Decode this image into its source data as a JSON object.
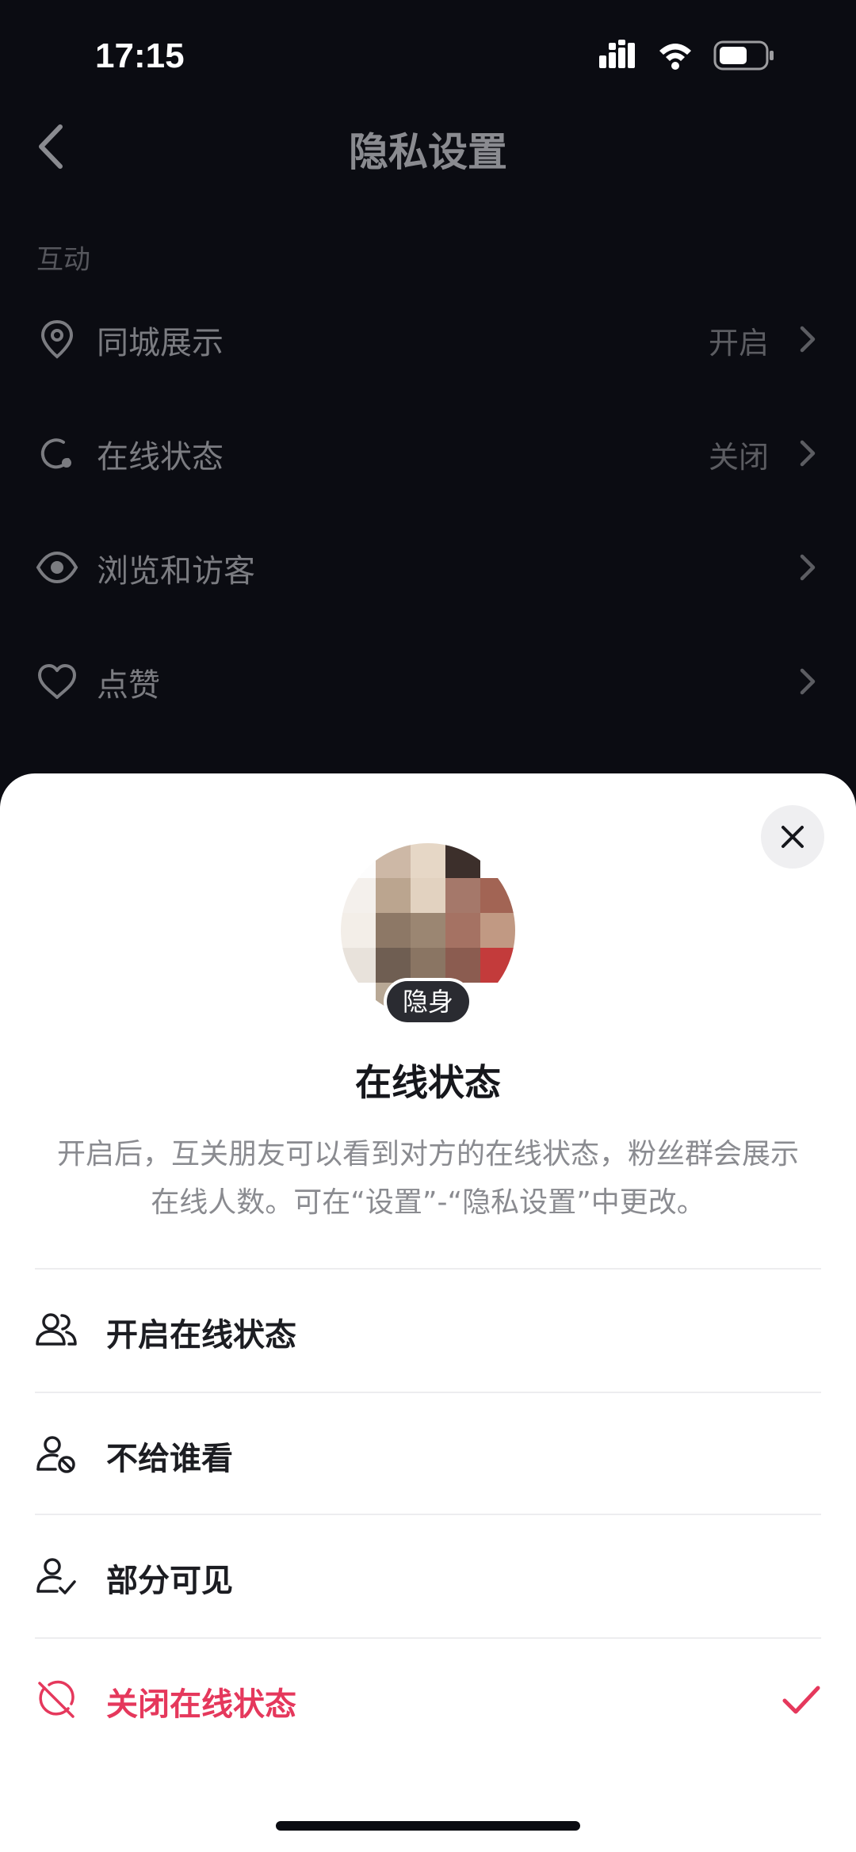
{
  "status_bar": {
    "time": "17:15",
    "icons": [
      "signal-icon",
      "wifi-icon",
      "battery-icon"
    ]
  },
  "nav": {
    "title": "隐私设置",
    "back_icon": "chevron-left-icon"
  },
  "section": {
    "label": "互动"
  },
  "settings": [
    {
      "icon": "location-pin-icon",
      "label": "同城展示",
      "value": "开启"
    },
    {
      "icon": "online-status-icon",
      "label": "在线状态",
      "value": "关闭"
    },
    {
      "icon": "eye-icon",
      "label": "浏览和访客",
      "value": ""
    },
    {
      "icon": "heart-icon",
      "label": "点赞",
      "value": ""
    }
  ],
  "sheet": {
    "badge": "隐身",
    "title": "在线状态",
    "description": "开启后，互关朋友可以看到对方的在线状态，粉丝群会展示在线人数。可在“设置”-“隐私设置”中更改。",
    "options": [
      {
        "icon": "group-icon",
        "label": "开启在线状态",
        "selected": false
      },
      {
        "icon": "user-blocked-icon",
        "label": "不给谁看",
        "selected": false
      },
      {
        "icon": "user-check-icon",
        "label": "部分可见",
        "selected": false
      },
      {
        "icon": "offline-status-icon",
        "label": "关闭在线状态",
        "selected": true
      }
    ]
  },
  "colors": {
    "background": "#0b0c12",
    "sheet": "#ffffff",
    "accent_selected": "#e5385c",
    "text_primary": "#1c1d22",
    "text_secondary": "#8a8b90"
  }
}
